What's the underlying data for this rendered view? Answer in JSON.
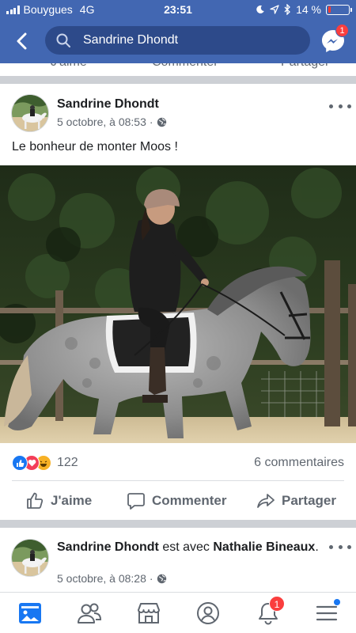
{
  "status_bar": {
    "carrier": "Bouygues",
    "network": "4G",
    "time": "23:51",
    "battery_percent": "14 %",
    "battery_level": 0.14,
    "icons": [
      "moon-icon",
      "location-icon",
      "bluetooth-icon",
      "battery-icon"
    ]
  },
  "header": {
    "search_value": "Sandrine Dhondt",
    "messenger_badge": "1",
    "icons": [
      "back-icon",
      "search-icon",
      "messenger-icon"
    ],
    "bg_color": "#4267b2"
  },
  "previous_post": {
    "like_label": "J'aime",
    "comment_label": "Commenter",
    "share_label": "Partager"
  },
  "post": {
    "author": "Sandrine Dhondt",
    "date": "5 octobre, à 08:53",
    "audience_icon": "globe-icon",
    "text": "Le bonheur de monter Moos !",
    "reactions": [
      "like",
      "love",
      "haha"
    ],
    "reaction_count": "122",
    "comments_count": "6 commentaires",
    "actions": {
      "like": "J'aime",
      "comment": "Commenter",
      "share": "Partager"
    }
  },
  "post2": {
    "author": "Sandrine Dhondt",
    "connector": " est avec ",
    "tagged": "Nathalie Bineaux",
    "suffix": ".",
    "date": "5 octobre, à 08:28",
    "audience_icon": "globe-icon"
  },
  "tab_bar": {
    "tabs": [
      "news-feed-icon",
      "friends-icon",
      "marketplace-icon",
      "profile-icon",
      "notifications-icon",
      "menu-icon"
    ],
    "active": "news-feed-icon",
    "notifications_badge": "1"
  },
  "colors": {
    "brand": "#4267b2",
    "active_tab": "#1877f2",
    "badge": "#fa3e3e",
    "secondary_text": "#606770"
  }
}
